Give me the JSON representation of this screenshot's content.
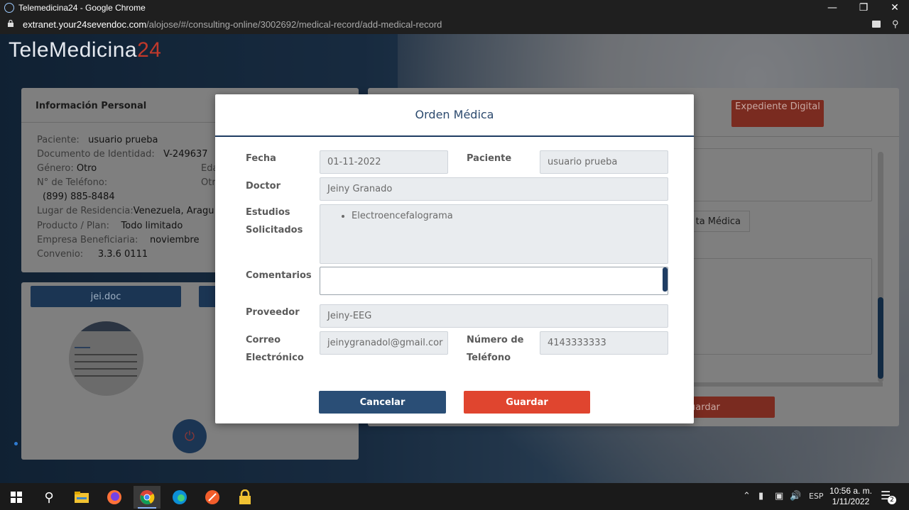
{
  "browser": {
    "window_title": "Telemedicina24 - Google Chrome",
    "url_host": "extranet.your24sevendoc.com",
    "url_path": "/alojose/#/consulting-online/3002692/medical-record/add-medical-record"
  },
  "logo": {
    "text": "TeleMedicina",
    "accent": "24"
  },
  "personal": {
    "heading": "Información Personal",
    "rows": [
      {
        "label": "Paciente:",
        "value": "usuario prueba"
      },
      {
        "label": "Documento de Identidad:",
        "value": "V-249637"
      },
      {
        "label": "Género:",
        "value": "Otro",
        "extra": "Eda"
      },
      {
        "label": "N° de Teléfono:",
        "value": "",
        "extra": "Otr"
      },
      {
        "label": "",
        "value": "(899) 885-8484"
      },
      {
        "label": "Lugar de Residencia:",
        "value": "Venezuela, Aragu"
      },
      {
        "label": "Producto / Plan:",
        "value": "Todo limitado"
      },
      {
        "label": "Empresa Beneficiaria:",
        "value": "noviembre"
      },
      {
        "label": "Convenio:",
        "value": "3.3.6 0111"
      }
    ]
  },
  "video": {
    "user_button": "jei.doc"
  },
  "right": {
    "exp_button": "Expediente Digital",
    "receta_button": "ta Médica",
    "guardar_button": "uardar"
  },
  "modal": {
    "title": "Orden Médica",
    "fecha_label": "Fecha",
    "fecha_value": "01-11-2022",
    "paciente_label": "Paciente",
    "paciente_value": "usuario prueba",
    "doctor_label": "Doctor",
    "doctor_value": "Jeiny Granado",
    "estudios_label_1": "Estudios",
    "estudios_label_2": "Solicitados",
    "estudios_items": [
      "Electroencefalograma"
    ],
    "comentarios_label": "Comentarios",
    "comentarios_value": "",
    "proveedor_label": "Proveedor",
    "proveedor_value": "Jeiny-EEG",
    "correo_label_1": "Correo",
    "correo_label_2": "Electrónico",
    "correo_value": "jeinygranadol@gmail.cor",
    "telefono_label_1": "Número de",
    "telefono_label_2": "Teléfono",
    "telefono_value": "4143333333",
    "cancel_button": "Cancelar",
    "save_button": "Guardar"
  },
  "taskbar": {
    "language": "ESP",
    "time": "10:56 a. m.",
    "date": "1/11/2022",
    "notifications": "2"
  },
  "colors": {
    "modal_title": "#2c4a6e",
    "cancel_button": "#2a4e76",
    "save_button": "#e0452f"
  }
}
